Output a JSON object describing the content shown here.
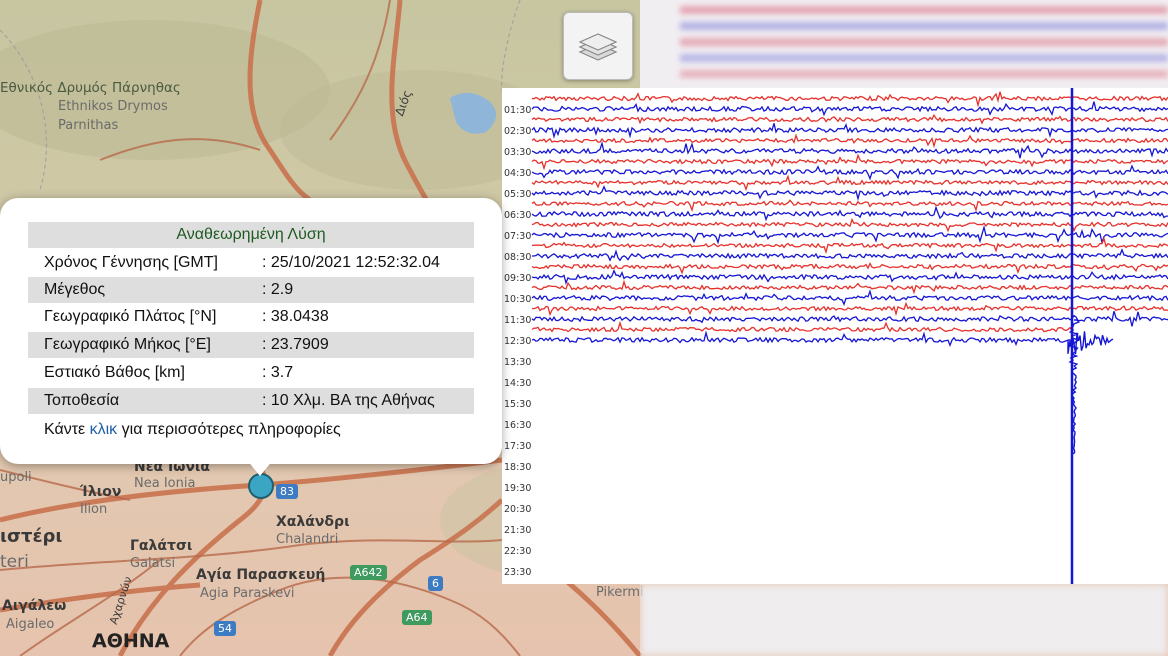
{
  "map": {
    "labels": {
      "park_gr": "Εθνικός Δρυμός Πάρνηθας",
      "park_lat1": "Ethnikos Drymos",
      "park_lat2": "Parnithas",
      "road_dios": "Διός",
      "nea_ionia_gr": "Νέα Ιωνία",
      "nea_ionia_lat": "Nea Ionia",
      "upoli": "upoli",
      "ilion_gr": "Ίλιον",
      "ilion_lat": "Ilion",
      "peri_gr": "ιστέρι",
      "peri_lat": "teri",
      "chalandri_gr": "Χαλάνδρι",
      "chalandri_lat": "Chalandri",
      "galatsi_gr": "Γαλάτσι",
      "galatsi_lat": "Galatsi",
      "agia_gr": "Αγία Παρασκευή",
      "agia_lat": "Agia Paraskevi",
      "aigaleo_gr": "Αιγάλεω",
      "aigaleo_lat": "Aigaleo",
      "athina_gr": "ΑΘΗΝΑ",
      "road_acharnon": "Αχαρνών",
      "pikermi": "Pikermi"
    },
    "shields": {
      "r83": "83",
      "a642": "A642",
      "r6": "6",
      "a64": "A64",
      "r54": "54"
    }
  },
  "popup": {
    "title": "Αναθεωρημένη Λύση",
    "rows": [
      {
        "label": "Χρόνος Γέννησης [GMT]",
        "value": ": 25/10/2021 12:52:32.04"
      },
      {
        "label": "Μέγεθος",
        "value": ": 2.9"
      },
      {
        "label": "Γεωγραφικό Πλάτος [°N]",
        "value": ": 38.0438"
      },
      {
        "label": "Γεωγραφικό Μήκος [°E]",
        "value": ": 23.7909"
      },
      {
        "label": "Εστιακό Βάθος [km]",
        "value": ": 3.7"
      },
      {
        "label": "Τοποθεσία",
        "value": ": 10 Χλμ. ΒΑ της Αθήνας"
      }
    ],
    "more_prefix": "Κάντε ",
    "more_link": "κλικ",
    "more_suffix": " για περισσότερες πληροφορίες"
  },
  "seismogram": {
    "time_labels": [
      "01:30",
      "02:30",
      "03:30",
      "04:30",
      "05:30",
      "06:30",
      "07:30",
      "08:30",
      "09:30",
      "10:30",
      "11:30",
      "12:30",
      "13:30",
      "14:30",
      "15:30",
      "16:30",
      "17:30",
      "18:30",
      "19:30",
      "20:30",
      "21:30",
      "22:30",
      "23:30"
    ],
    "recorded_rows": 12,
    "colors": {
      "trace_a": "#e8302a",
      "trace_b": "#1515d6",
      "event": "#1515d6"
    }
  },
  "icons": {
    "layers": "layers-icon"
  }
}
